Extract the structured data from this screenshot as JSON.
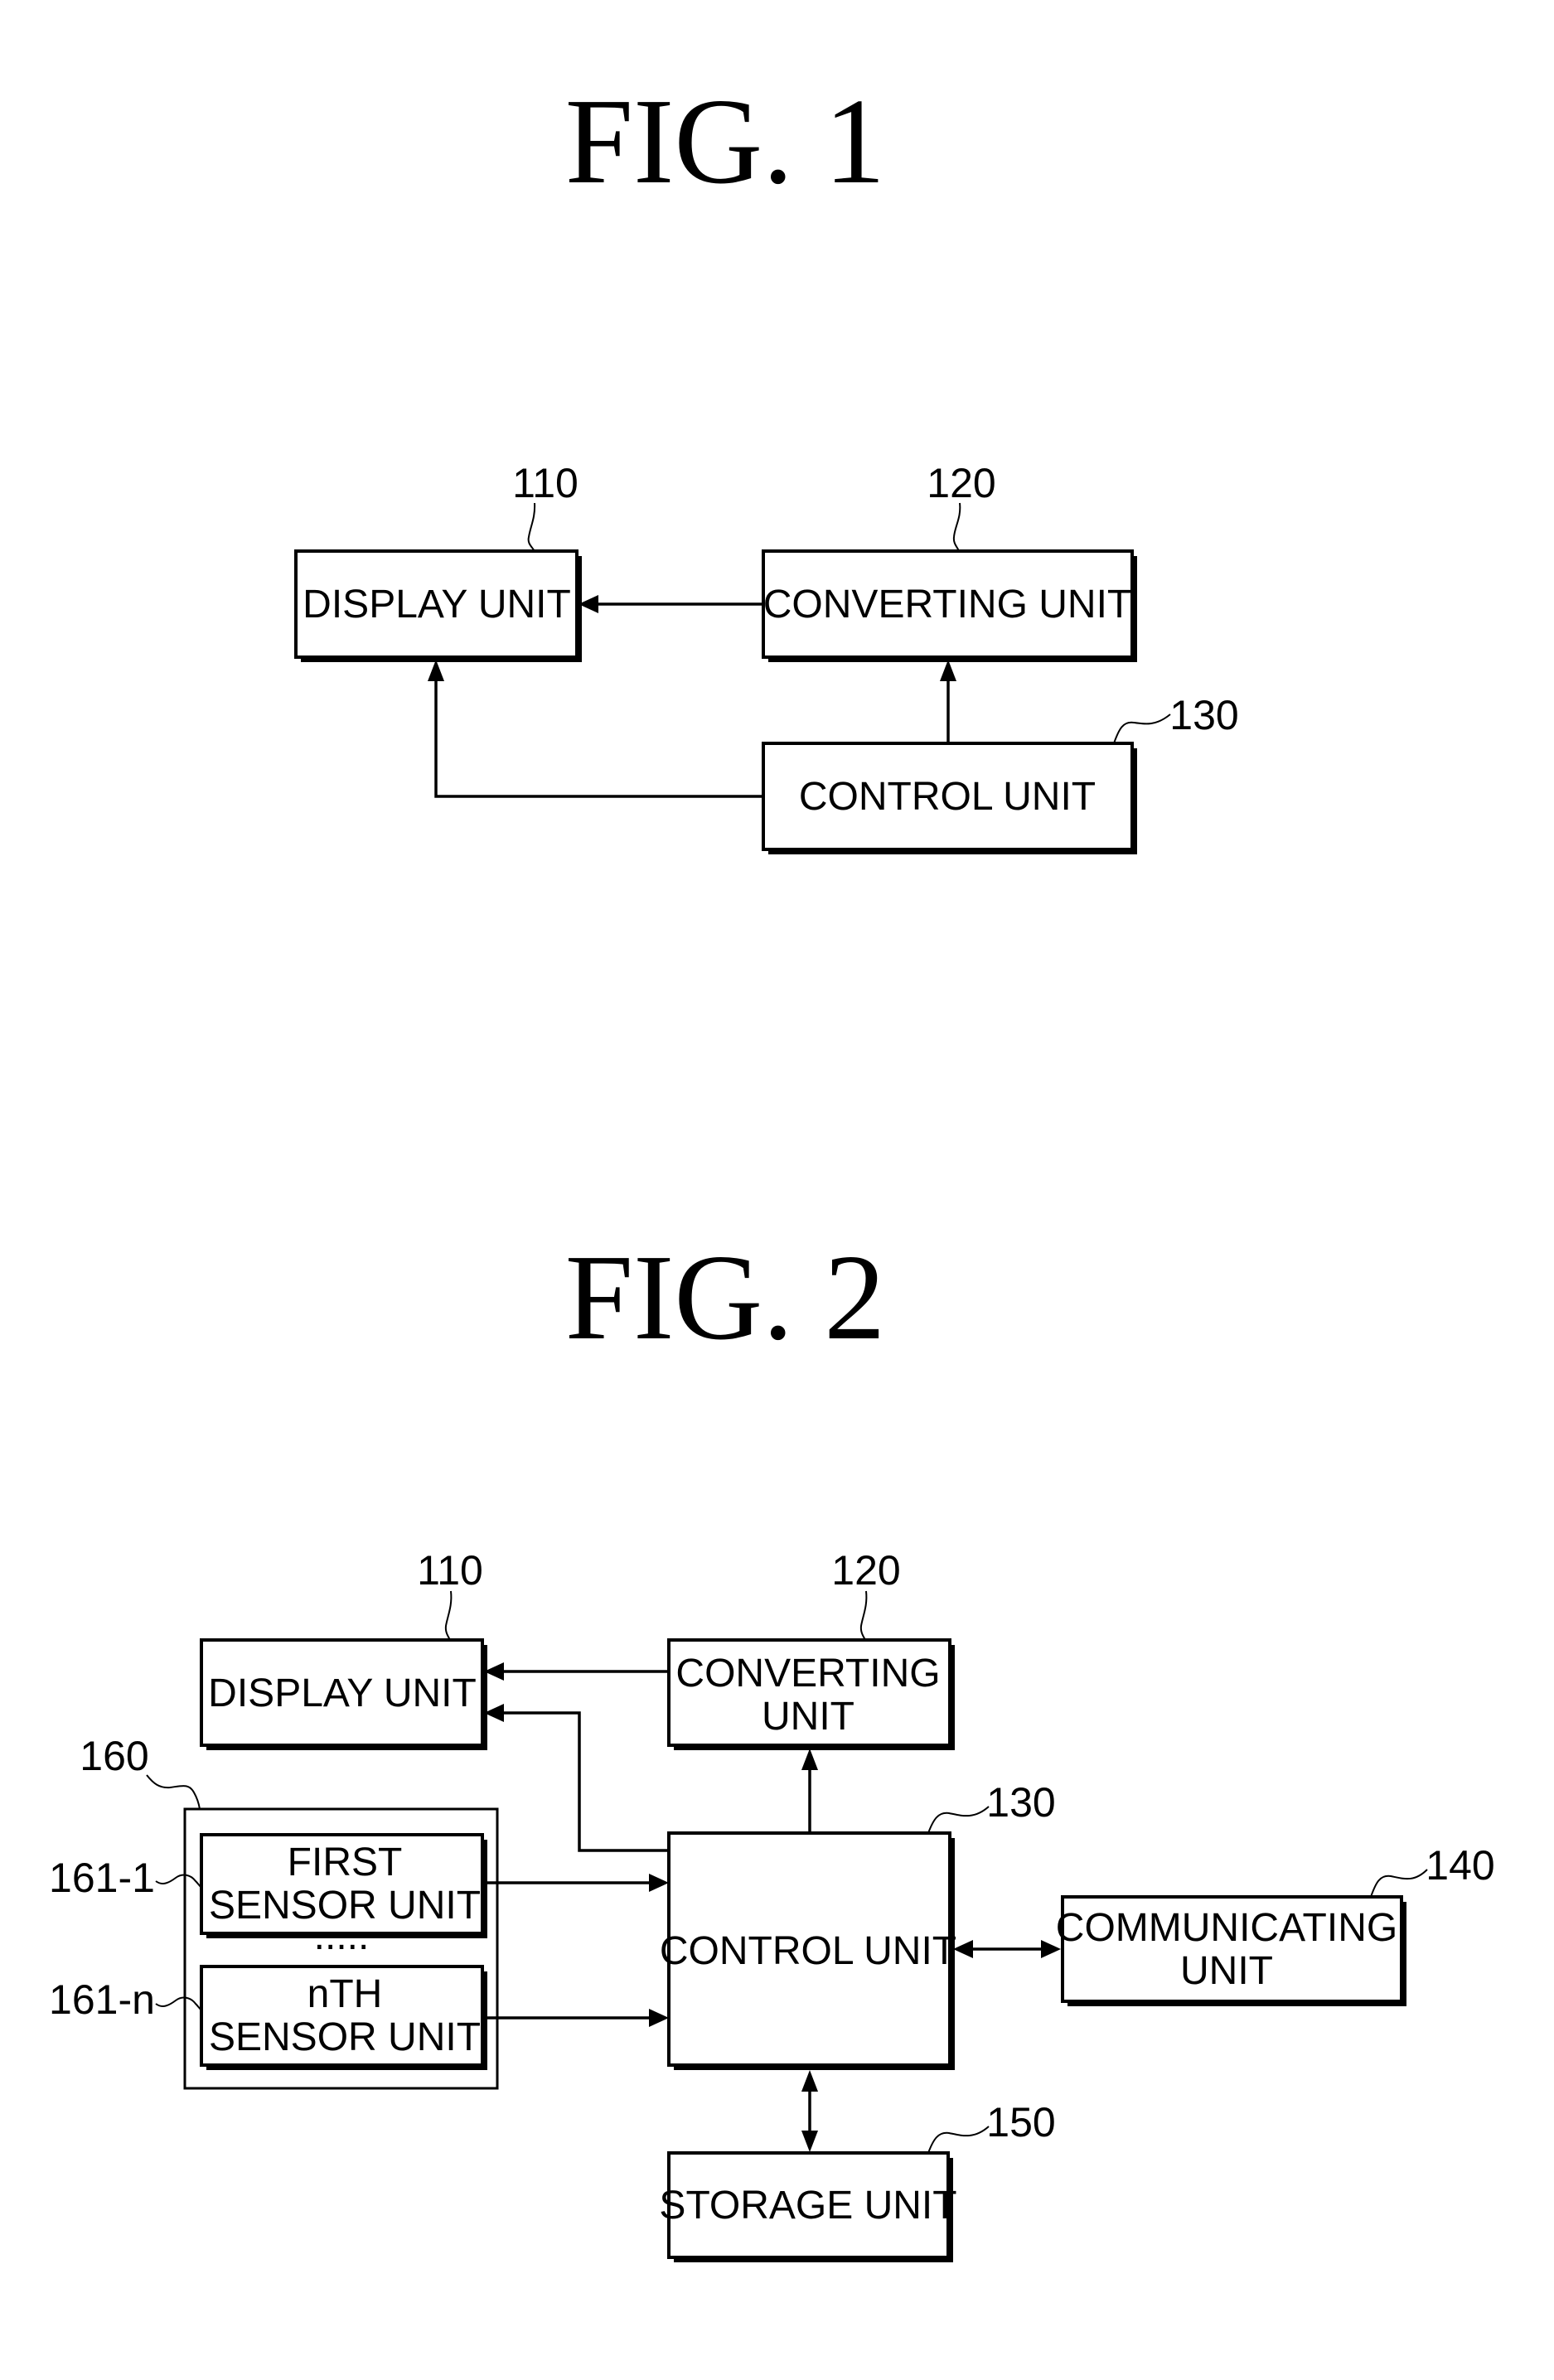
{
  "figures": [
    {
      "title": "FIG.  1",
      "blocks": {
        "display": {
          "label": "DISPLAY UNIT",
          "ref": "110"
        },
        "converting": {
          "label": "CONVERTING UNIT",
          "ref": "120"
        },
        "control": {
          "label": "CONTROL UNIT",
          "ref": "130"
        }
      },
      "connections": [
        {
          "from": "converting",
          "to": "display",
          "direction": "one-way"
        },
        {
          "from": "control",
          "to": "converting",
          "direction": "one-way"
        },
        {
          "from": "control",
          "to": "display",
          "direction": "one-way"
        }
      ]
    },
    {
      "title": "FIG.  2",
      "blocks": {
        "display": {
          "label": "DISPLAY UNIT",
          "ref": "110"
        },
        "converting": {
          "label_line1": "CONVERTING",
          "label_line2": "UNIT",
          "ref": "120"
        },
        "control": {
          "label": "CONTROL UNIT",
          "ref": "130"
        },
        "communicating": {
          "label_line1": "COMMUNICATING",
          "label_line2": "UNIT",
          "ref": "140"
        },
        "storage": {
          "label": "STORAGE UNIT",
          "ref": "150"
        },
        "sensor_group": {
          "ref": "160",
          "ellipsis": "....."
        },
        "first_sensor": {
          "label_line1": "FIRST",
          "label_line2": "SENSOR UNIT",
          "ref": "161-1"
        },
        "nth_sensor": {
          "label_line1": "nTH",
          "label_line2": "SENSOR UNIT",
          "ref": "161-n"
        }
      },
      "connections": [
        {
          "from": "converting",
          "to": "display",
          "direction": "one-way"
        },
        {
          "from": "control",
          "to": "display",
          "direction": "one-way"
        },
        {
          "from": "control",
          "to": "converting",
          "direction": "one-way"
        },
        {
          "from": "first_sensor",
          "to": "control",
          "direction": "one-way"
        },
        {
          "from": "nth_sensor",
          "to": "control",
          "direction": "one-way"
        },
        {
          "from": "control",
          "to": "communicating",
          "direction": "two-way"
        },
        {
          "from": "control",
          "to": "storage",
          "direction": "two-way"
        }
      ]
    }
  ]
}
